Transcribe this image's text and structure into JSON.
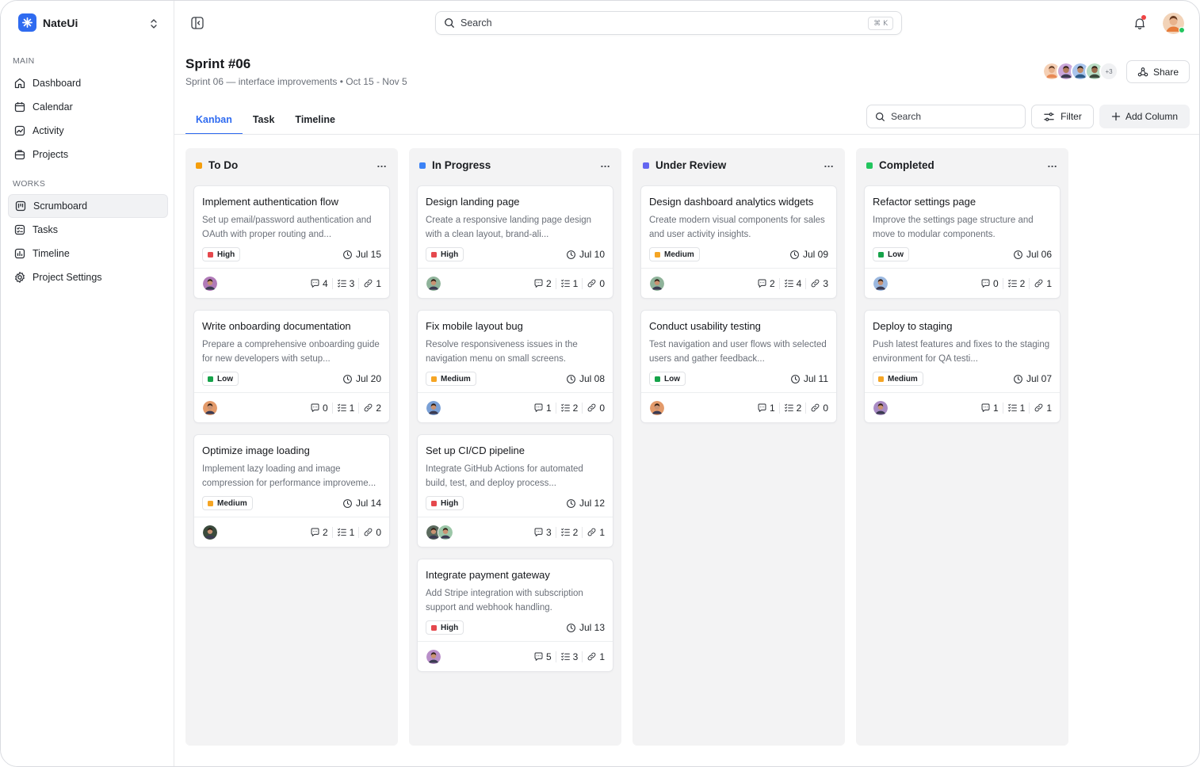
{
  "app": {
    "name": "NateUi"
  },
  "sidebar": {
    "main_label": "MAIN",
    "works_label": "WORKS",
    "main_items": [
      {
        "label": "Dashboard",
        "icon": "home-icon"
      },
      {
        "label": "Calendar",
        "icon": "calendar-icon"
      },
      {
        "label": "Activity",
        "icon": "activity-icon"
      },
      {
        "label": "Projects",
        "icon": "briefcase-icon"
      }
    ],
    "works_items": [
      {
        "label": "Scrumboard",
        "icon": "scrumboard-icon",
        "active": true
      },
      {
        "label": "Tasks",
        "icon": "checklist-icon"
      },
      {
        "label": "Timeline",
        "icon": "chart-bars-icon"
      },
      {
        "label": "Project Settings",
        "icon": "gear-icon"
      }
    ]
  },
  "topbar": {
    "search_placeholder": "Search",
    "search_shortcut": "⌘ K"
  },
  "header": {
    "title": "Sprint #06",
    "subtitle": "Sprint 06 — interface improvements • Oct 15 - Nov 5",
    "extra_members": "+3",
    "share_label": "Share"
  },
  "tabs": [
    {
      "label": "Kanban",
      "active": true
    },
    {
      "label": "Task"
    },
    {
      "label": "Timeline"
    }
  ],
  "toolbar": {
    "search_placeholder": "Search",
    "filter_label": "Filter",
    "add_column_label": "Add Column"
  },
  "priority_colors": {
    "High": "#e5484d",
    "Medium": "#f5a524",
    "Low": "#16a34a"
  },
  "columns": [
    {
      "name": "To Do",
      "color": "#f59e0b",
      "more": "...",
      "cards": [
        {
          "title": "Implement authentication flow",
          "desc": "Set up email/password authentication and OAuth with proper routing and...",
          "priority": "High",
          "due": "Jul 15",
          "comments": "4",
          "subtasks": "3",
          "links": "1",
          "avatars": [
            "#b07ab8"
          ]
        },
        {
          "title": "Write onboarding documentation",
          "desc": "Prepare a comprehensive onboarding guide for new developers with setup...",
          "priority": "Low",
          "due": "Jul 20",
          "comments": "0",
          "subtasks": "1",
          "links": "2",
          "avatars": [
            "#e39a6a"
          ]
        },
        {
          "title": "Optimize image loading",
          "desc": "Implement lazy loading and image compression for performance improveme...",
          "priority": "Medium",
          "due": "Jul 14",
          "comments": "2",
          "subtasks": "1",
          "links": "0",
          "avatars": [
            "#3a4a3c"
          ]
        }
      ]
    },
    {
      "name": "In Progress",
      "color": "#3b82f6",
      "more": "...",
      "cards": [
        {
          "title": "Design landing page",
          "desc": "Create a responsive landing page design with a clean layout, brand-ali...",
          "priority": "High",
          "due": "Jul 10",
          "comments": "2",
          "subtasks": "1",
          "links": "0",
          "avatars": [
            "#8fb39a"
          ]
        },
        {
          "title": "Fix mobile layout bug",
          "desc": "Resolve responsiveness issues in the navigation menu on small screens.",
          "priority": "Medium",
          "due": "Jul 08",
          "comments": "1",
          "subtasks": "2",
          "links": "0",
          "avatars": [
            "#7aa0d6"
          ]
        },
        {
          "title": "Set up CI/CD pipeline",
          "desc": "Integrate GitHub Actions for automated build, test, and deploy process...",
          "priority": "High",
          "due": "Jul 12",
          "comments": "3",
          "subtasks": "2",
          "links": "1",
          "avatars": [
            "#5b6b5e",
            "#9cc7a8"
          ]
        },
        {
          "title": "Integrate payment gateway",
          "desc": "Add Stripe integration with subscription support and webhook handling.",
          "priority": "High",
          "due": "Jul 13",
          "comments": "5",
          "subtasks": "3",
          "links": "1",
          "avatars": [
            "#b98fc9"
          ]
        }
      ]
    },
    {
      "name": "Under Review",
      "color": "#6366f1",
      "more": "...",
      "cards": [
        {
          "title": "Design dashboard analytics widgets",
          "desc": "Create modern visual components for sales and user activity insights.",
          "priority": "Medium",
          "due": "Jul 09",
          "comments": "2",
          "subtasks": "4",
          "links": "3",
          "avatars": [
            "#8fb39a"
          ]
        },
        {
          "title": "Conduct usability testing",
          "desc": "Test navigation and user flows with selected users and gather feedback...",
          "priority": "Low",
          "due": "Jul 11",
          "comments": "1",
          "subtasks": "2",
          "links": "0",
          "avatars": [
            "#e39a6a"
          ]
        }
      ]
    },
    {
      "name": "Completed",
      "color": "#22c55e",
      "more": "...",
      "cards": [
        {
          "title": "Refactor settings page",
          "desc": "Improve the settings page structure and move to modular components.",
          "priority": "Low",
          "due": "Jul 06",
          "comments": "0",
          "subtasks": "2",
          "links": "1",
          "avatars": [
            "#9bb8e0"
          ]
        },
        {
          "title": "Deploy to staging",
          "desc": "Push latest features and fixes to the staging environment for QA testi...",
          "priority": "Medium",
          "due": "Jul 07",
          "comments": "1",
          "subtasks": "1",
          "links": "1",
          "avatars": [
            "#a98bc4"
          ]
        }
      ]
    }
  ]
}
